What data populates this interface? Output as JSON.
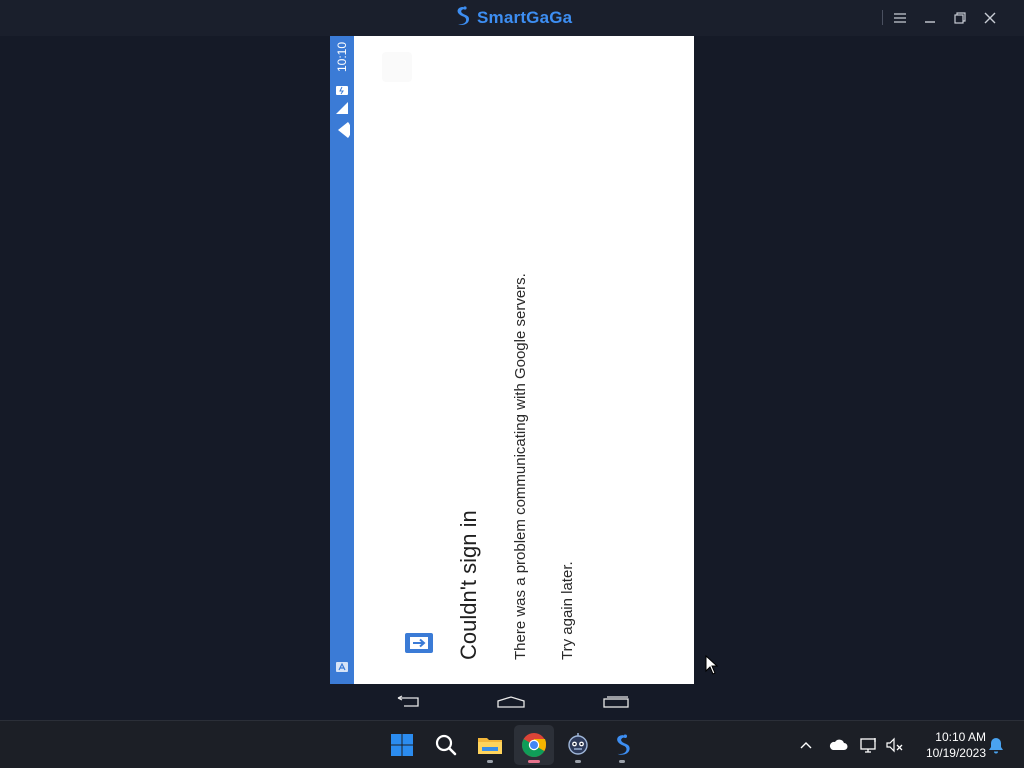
{
  "emulator": {
    "brand": "SmartGaGa",
    "colors": {
      "brand_blue": "#3d8ef2",
      "window_bg": "#151a27"
    },
    "window_controls": [
      "menu-icon",
      "minimize-icon",
      "restore-icon",
      "close-icon"
    ]
  },
  "android": {
    "status_time": "10:10",
    "status_icons": [
      "battery-icon",
      "signal-icon",
      "wifi-icon"
    ],
    "status_color": "#3b7bd6",
    "dialog": {
      "title": "Couldn't sign in",
      "message": "There was a problem communicating with Google servers.",
      "retry": "Try again later."
    },
    "nav": [
      "back-icon",
      "home-icon",
      "recents-icon"
    ]
  },
  "taskbar": {
    "apps": [
      "windows-start-icon",
      "search-icon",
      "file-explorer-icon",
      "chrome-icon",
      "robot-app-icon",
      "smartgaga-icon"
    ],
    "tray_icons": [
      "chevron-up-icon",
      "onedrive-cloud-icon",
      "network-icon",
      "volume-muted-icon",
      "notification-bell-icon"
    ],
    "time": "10:10 AM",
    "date": "10/19/2023"
  }
}
